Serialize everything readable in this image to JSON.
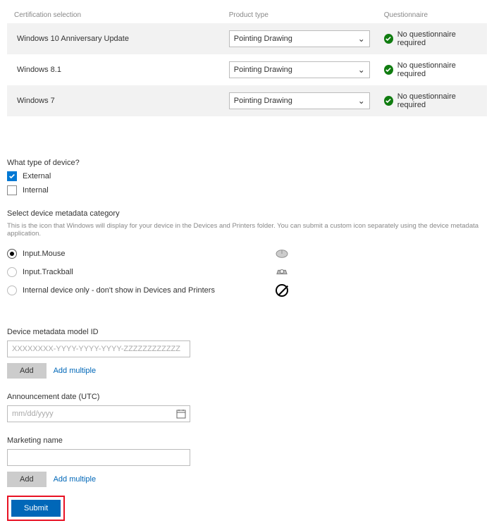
{
  "headers": {
    "cert": "Certification selection",
    "product": "Product type",
    "quest": "Questionnaire"
  },
  "rows": [
    {
      "name": "Windows 10 Anniversary Update",
      "product": "Pointing Drawing",
      "status": "No questionnaire required"
    },
    {
      "name": "Windows 8.1",
      "product": "Pointing Drawing",
      "status": "No questionnaire required"
    },
    {
      "name": "Windows 7",
      "product": "Pointing Drawing",
      "status": "No questionnaire required"
    }
  ],
  "device_type": {
    "label": "What type of device?",
    "external": "External",
    "internal": "Internal"
  },
  "metadata_cat": {
    "label": "Select device metadata category",
    "help": "This is the icon that Windows will display for your device in the Devices and Printers folder. You can submit a custom icon separately using the device metadata application.",
    "opts": [
      "Input.Mouse",
      "Input.Trackball",
      "Internal device only - don't show in Devices and Printers"
    ]
  },
  "model_id": {
    "label": "Device metadata model ID",
    "placeholder": "XXXXXXXX-YYYY-YYYY-YYYY-ZZZZZZZZZZZZ",
    "add": "Add",
    "multi": "Add multiple"
  },
  "announce": {
    "label": "Announcement date (UTC)",
    "placeholder": "mm/dd/yyyy"
  },
  "marketing": {
    "label": "Marketing name",
    "add": "Add",
    "multi": "Add multiple"
  },
  "submit": "Submit"
}
